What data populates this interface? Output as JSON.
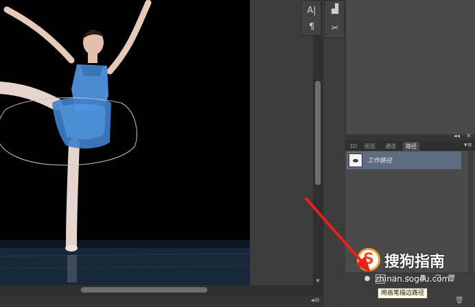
{
  "typography_panel": {
    "character_icon": "character-icon",
    "paragraph_icon": "paragraph-icon"
  },
  "tools_strip": {
    "brush_preset_icon": "brush-preset-icon",
    "tool_options_icon": "tool-options-icon"
  },
  "paths_panel": {
    "tabs": [
      {
        "label": "3D"
      },
      {
        "label": "图层"
      },
      {
        "label": "通道"
      },
      {
        "label": "路径"
      }
    ],
    "active_tab": "路径",
    "items": [
      {
        "name": "工作路径",
        "selected": true
      }
    ],
    "buttons": [
      {
        "name": "fill-path-button",
        "icon": "filled-circle-icon",
        "glyph": "●"
      },
      {
        "name": "stroke-path-button",
        "icon": "hollow-circle-icon",
        "glyph": "○"
      },
      {
        "name": "load-as-selection-button",
        "icon": "dotted-circle-icon",
        "glyph": "◌"
      },
      {
        "name": "make-work-path-button",
        "icon": "path-diamond-icon",
        "glyph": "◇"
      },
      {
        "name": "add-mask-button",
        "icon": "mask-icon",
        "glyph": "◘"
      },
      {
        "name": "new-path-button",
        "icon": "new-page-icon",
        "glyph": "❐"
      },
      {
        "name": "delete-path-button",
        "icon": "trash-icon",
        "glyph": "🗑"
      }
    ]
  },
  "tooltip": {
    "text": "用画笔描边路径"
  },
  "watermark": {
    "logo_letter": "S",
    "brand": "搜狗指南",
    "url": "zhinan.sogou.com"
  },
  "colors": {
    "panel_bg": "#4a4a4a",
    "selected_row": "#5d6c80",
    "annotation_arrow": "#e8201a",
    "tooltip_bg": "#ffffe1"
  }
}
